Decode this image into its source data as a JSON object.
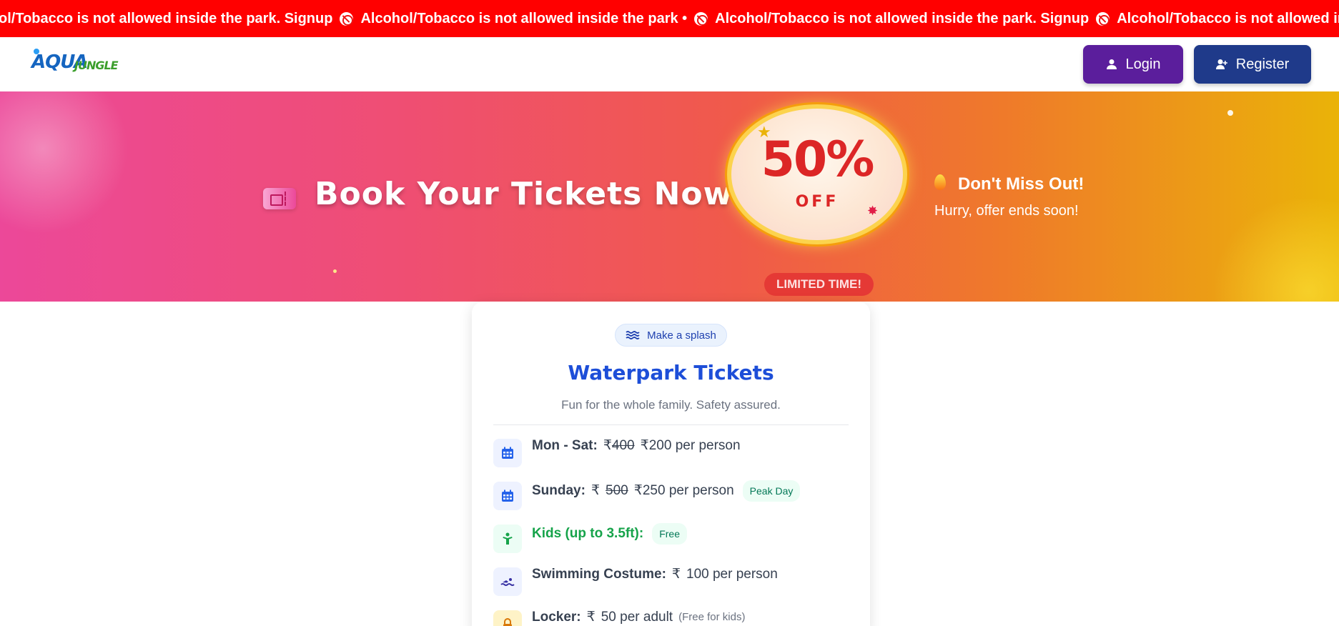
{
  "marquee": {
    "items": [
      "ol/Tobacco is not allowed inside the park. Signup",
      "Alcohol/Tobacco is not allowed inside the park •",
      "Alcohol/Tobacco is not allowed inside the park. Signup",
      "Alcohol/Tobacco is not allowed inside the"
    ],
    "color": "#ff0000"
  },
  "navbar": {
    "logo": {
      "word1": "AQUA",
      "word2": "JUNGLE"
    },
    "login_label": "Login",
    "register_label": "Register"
  },
  "hero": {
    "title": "Book Your Tickets Now!",
    "discount": "50%",
    "discount_suffix": "OFF",
    "limited": "LIMITED TIME!",
    "promo_title": "Don't Miss Out!",
    "promo_sub": "Hurry, offer ends soon!"
  },
  "card": {
    "chip": "Make a splash",
    "title": "Waterpark Tickets",
    "subtitle": "Fun for the whole family. Safety assured.",
    "rows": [
      {
        "icon": "calendar-icon",
        "label": "Mon - Sat:",
        "currency": "₹",
        "old_price": "400",
        "new_currency": "₹",
        "new_price": "200 per person"
      },
      {
        "icon": "calendar-icon",
        "label": "Sunday:",
        "currency": "₹",
        "old_price": "500",
        "new_currency": "₹",
        "new_price": "250 per person",
        "badge": "Peak Day"
      },
      {
        "icon": "child-icon",
        "label": "Kids (up to 3.5ft):",
        "badge": "Free"
      },
      {
        "icon": "swimmer-icon",
        "label": "Swimming Costume:",
        "currency": "₹",
        "price": "100 per person"
      },
      {
        "icon": "lock-icon",
        "label": "Locker:",
        "currency": "₹",
        "price": "50 per adult",
        "note": "(Free for kids)"
      }
    ]
  }
}
